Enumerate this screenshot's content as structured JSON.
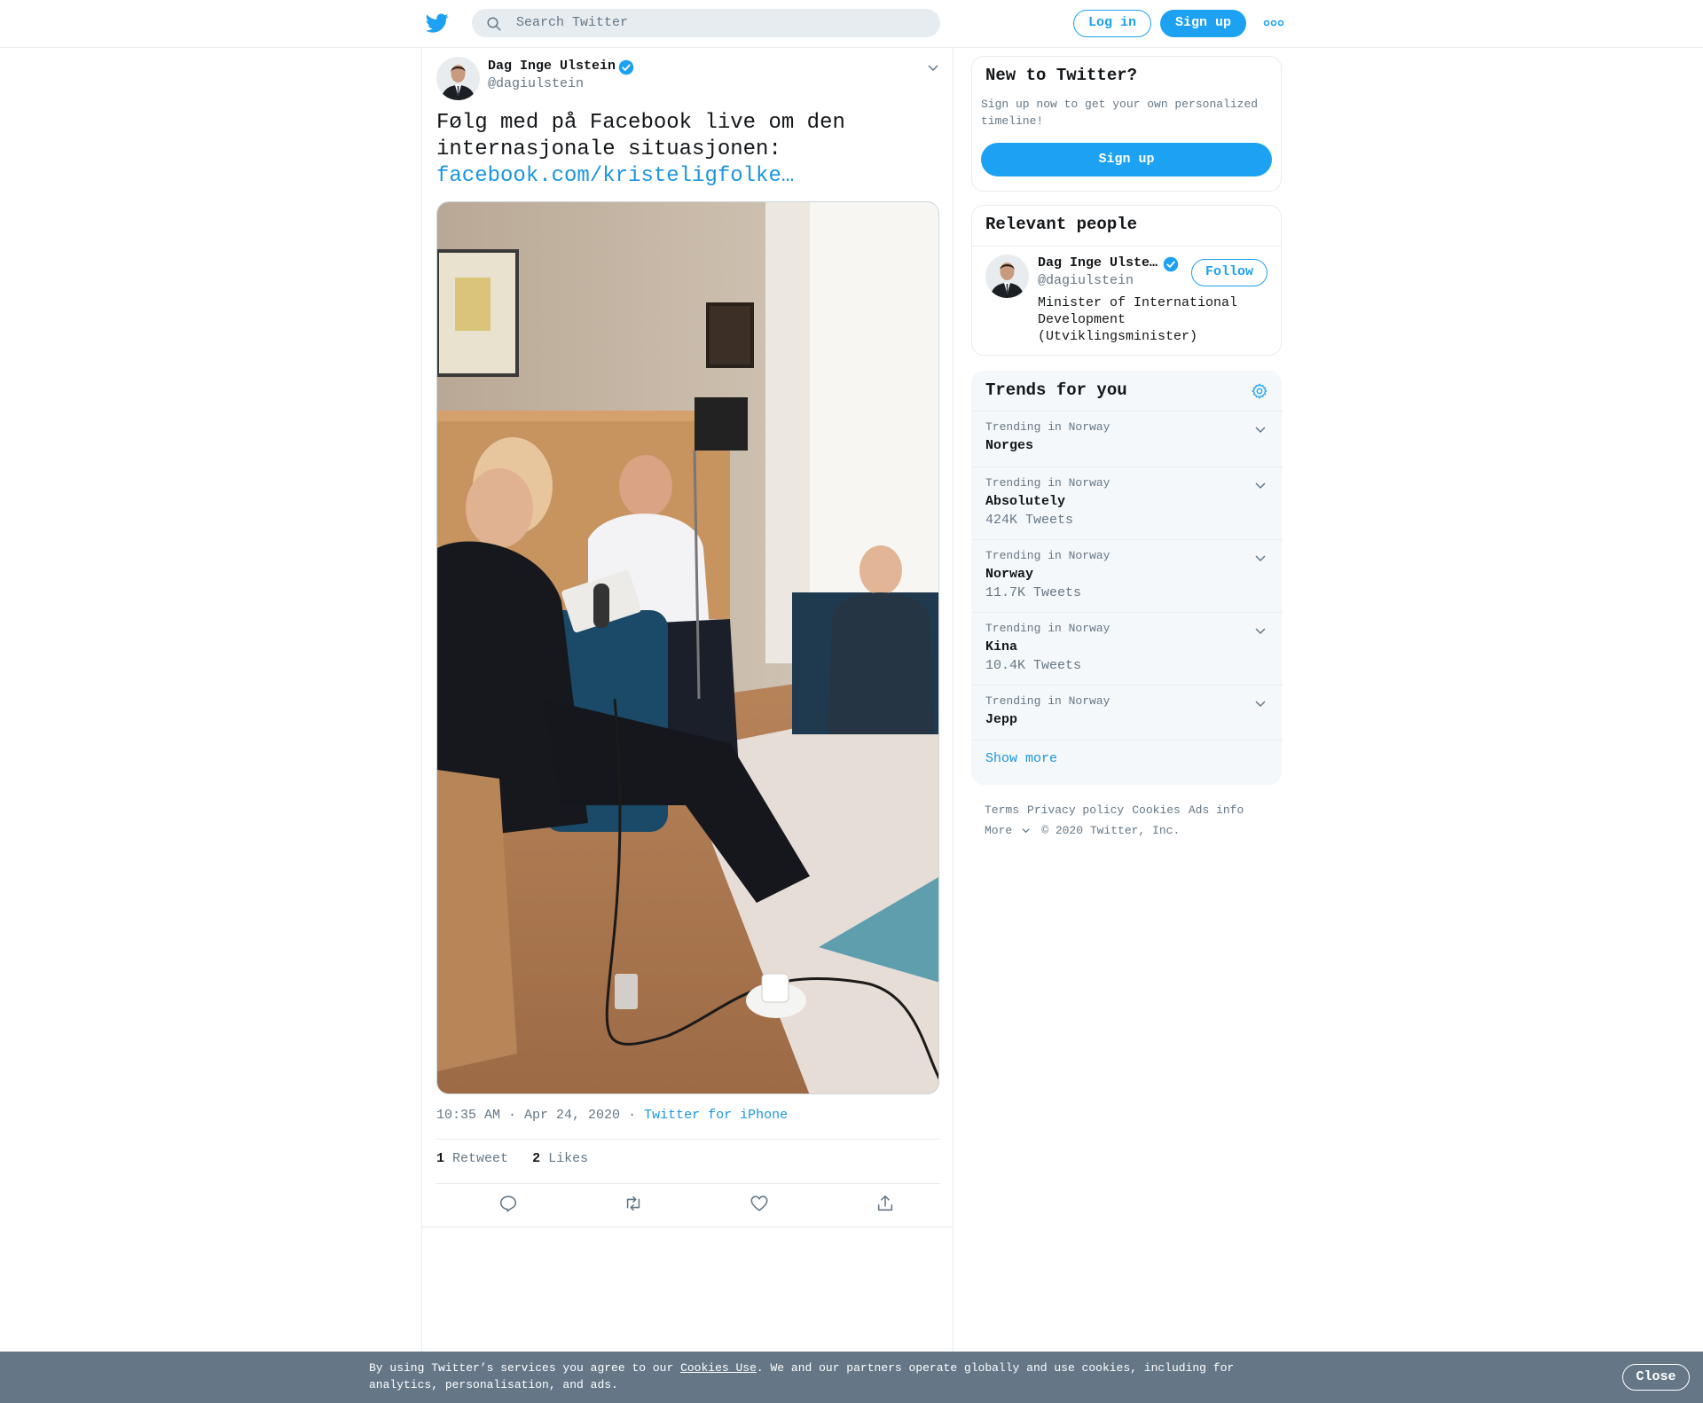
{
  "header": {
    "search_placeholder": "Search Twitter",
    "login_label": "Log in",
    "signup_label": "Sign up",
    "brand_color": "#1da1f2"
  },
  "tweet": {
    "author_name": "Dag Inge Ulstein",
    "author_handle": "@dagiulstein",
    "text_line1": "Følg med på Facebook live om den",
    "text_line2": "internasjonale situasjonen:",
    "link_text": "facebook.com/kristeligfolke…",
    "time": "10:35 AM · Apr 24, 2020",
    "source": "Twitter for iPhone",
    "retweet_count": "1",
    "retweet_label": "Retweet",
    "like_count": "2",
    "like_label": "Likes"
  },
  "sidebar": {
    "new_to_twitter": {
      "title": "New to Twitter?",
      "text": "Sign up now to get your own personalized timeline!",
      "button": "Sign up"
    },
    "relevant_people": {
      "title": "Relevant people",
      "name": "Dag Inge Ulste…",
      "handle": "@dagiulstein",
      "bio": "Minister of International Development (Utviklingsminister)",
      "follow_label": "Follow"
    },
    "trends": {
      "title": "Trends for you",
      "items": [
        {
          "context": "Trending in Norway",
          "name": "Norges",
          "count": ""
        },
        {
          "context": "Trending in Norway",
          "name": "Absolutely",
          "count": "424K Tweets"
        },
        {
          "context": "Trending in Norway",
          "name": "Norway",
          "count": "11.7K Tweets"
        },
        {
          "context": "Trending in Norway",
          "name": "Kina",
          "count": "10.4K Tweets"
        },
        {
          "context": "Trending in Norway",
          "name": "Jepp",
          "count": ""
        }
      ],
      "show_more": "Show more"
    },
    "footer": {
      "terms": "Terms",
      "privacy": "Privacy policy",
      "cookies": "Cookies",
      "ads": "Ads info",
      "more": "More",
      "copyright": "© 2020 Twitter, Inc."
    }
  },
  "cookie_banner": {
    "text_before": "By using Twitter’s services you agree to our ",
    "link": "Cookies Use",
    "text_after": ". We and our partners operate globally and use cookies, including for analytics, personalisation, and ads.",
    "close_label": "Close"
  }
}
